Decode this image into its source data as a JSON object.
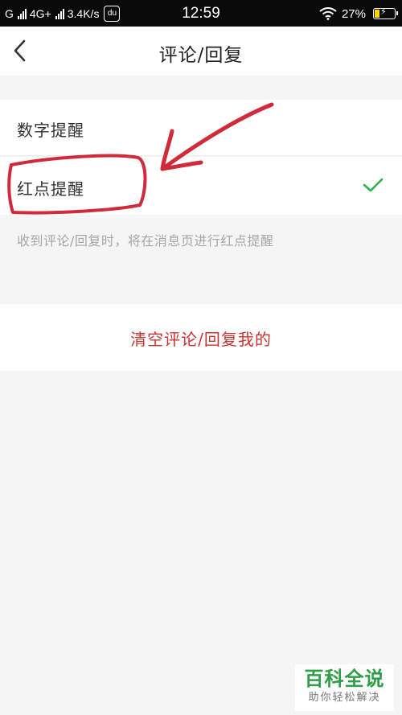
{
  "status_bar": {
    "carrier1": "G",
    "network": "4G+",
    "speed": "3.4K/s",
    "app_badge": "du",
    "time": "12:59",
    "battery_percent": "27%",
    "battery_level": 0.27,
    "icons": [
      "signal-icon",
      "wifi-icon",
      "battery-charging-icon"
    ]
  },
  "nav": {
    "back_icon": "chevron-left-icon",
    "title": "评论/回复"
  },
  "settings": {
    "options": [
      {
        "label": "数字提醒",
        "selected": false
      },
      {
        "label": "红点提醒",
        "selected": true
      }
    ],
    "check_icon": "checkmark-icon",
    "check_color": "#2bb34a",
    "hint": "收到评论/回复时，将在消息页进行红点提醒"
  },
  "clear_action": {
    "label": "清空评论/回复我的",
    "color": "#c8352f"
  },
  "annotation": {
    "color": "#d12a3a",
    "shapes": [
      "circle-around-option",
      "arrow-pointer"
    ]
  },
  "watermark": {
    "title": "百科全说",
    "subtitle": "助你轻松解决"
  }
}
